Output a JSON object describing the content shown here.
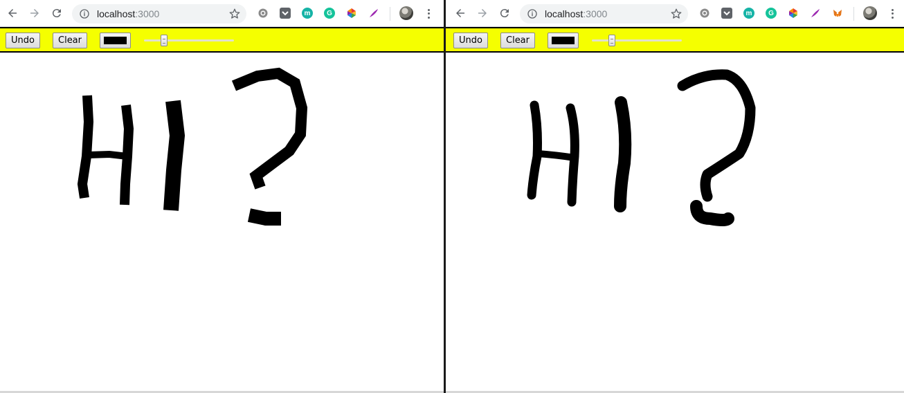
{
  "windows": [
    {
      "id": "left",
      "omnibox": {
        "host": "localhost",
        "port": ":3000"
      },
      "app": {
        "undo_label": "Undo",
        "clear_label": "Clear",
        "brush_color": "#000000",
        "brush_size_fraction": 0.2
      },
      "canvas": {
        "drawing": "HI?",
        "stroke_style": "jagged"
      }
    },
    {
      "id": "right",
      "omnibox": {
        "host": "localhost",
        "port": ":3000"
      },
      "app": {
        "undo_label": "Undo",
        "clear_label": "Clear",
        "brush_color": "#000000",
        "brush_size_fraction": 0.2
      },
      "canvas": {
        "drawing": "HI?",
        "stroke_style": "round"
      }
    }
  ],
  "browser": {
    "icons": [
      "back-icon",
      "forward-icon",
      "reload-icon",
      "info-icon",
      "star-icon",
      "gear-extension-icon",
      "pocket-icon",
      "m-extension-icon",
      "grammarly-icon",
      "color-wheel-icon",
      "feather-icon",
      "metamask-icon",
      "avatar",
      "menu-icon"
    ]
  },
  "colors": {
    "app_bar": "#f5ff00",
    "ink": "#000000",
    "omnibox_bg": "#f1f3f4"
  }
}
